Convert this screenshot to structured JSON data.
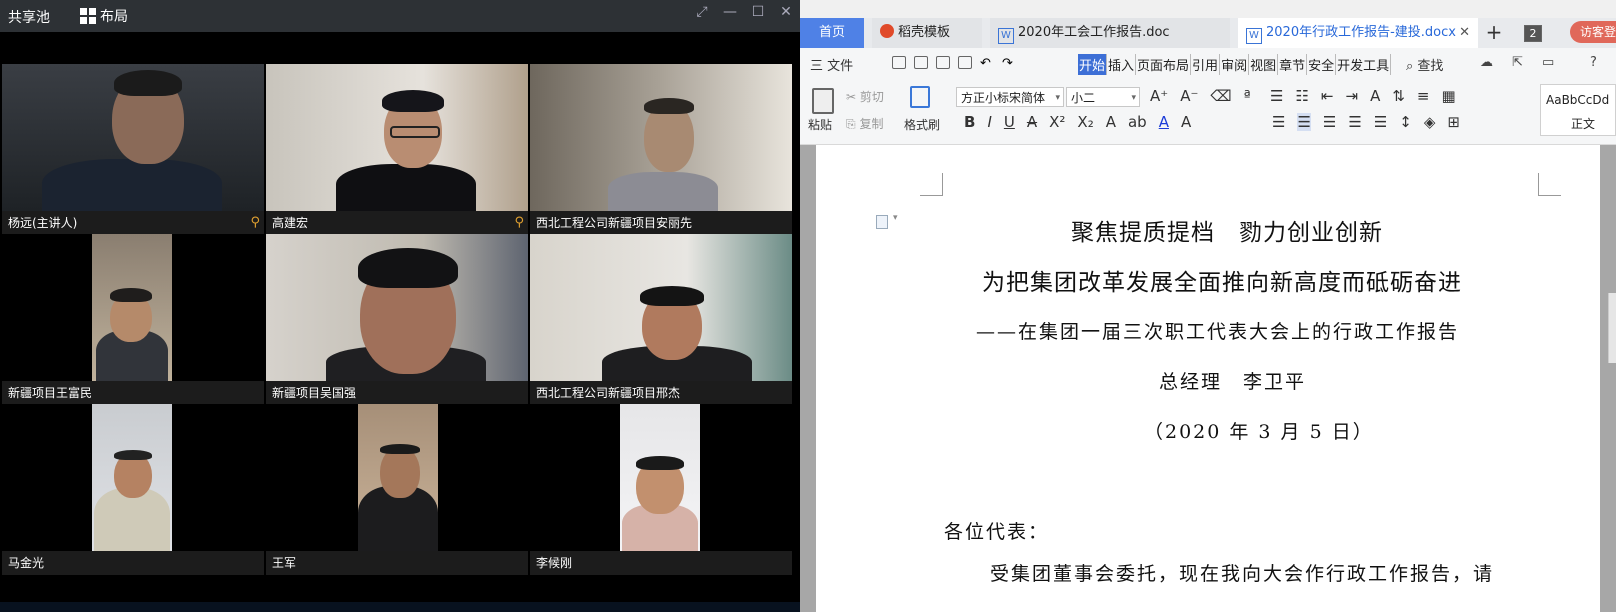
{
  "meeting": {
    "pool_label": "共享池",
    "layout_label": "布局",
    "participants": [
      {
        "name": "杨远(主讲人)",
        "pinned": true
      },
      {
        "name": "高建宏",
        "pinned": true
      },
      {
        "name": "西北工程公司新疆项目安丽先",
        "pinned": false
      },
      {
        "name": "新疆项目王富民",
        "pinned": false
      },
      {
        "name": "新疆项目吴国强",
        "pinned": false
      },
      {
        "name": "西北工程公司新疆项目邢杰",
        "pinned": false
      },
      {
        "name": "马金光",
        "pinned": false
      },
      {
        "name": "王军",
        "pinned": false
      },
      {
        "name": "李候刚",
        "pinned": false
      }
    ]
  },
  "wps": {
    "tabs": {
      "home": "首页",
      "daoke": "稻壳模板",
      "doc1": "2020年工会工作报告.doc",
      "doc2": "2020年行政工作报告-建投.docx"
    },
    "tab_count": "2",
    "visitor_label": "访客登",
    "file_menu": "三 文件",
    "menu_tabs": [
      "开始",
      "插入",
      "页面布局",
      "引用",
      "审阅",
      "视图",
      "章节",
      "安全",
      "开发工具"
    ],
    "find_label": "查找",
    "ribbon": {
      "paste": "粘贴",
      "cut": "剪切",
      "copy": "复制",
      "format_painter": "格式刷",
      "font_name": "方正小标宋简体",
      "font_size": "小二",
      "style_sample": "AaBbCcDd",
      "style_name": "正文"
    },
    "document": {
      "title1": "聚焦提质提档　勠力创业创新",
      "title2": "为把集团改革发展全面推向新高度而砥砺奋进",
      "subtitle": "——在集团一届三次职工代表大会上的行政工作报告",
      "author": "总经理　李卫平",
      "date": "（2020 年 3 月 5 日）",
      "greeting": "各位代表：",
      "para1": "受集团董事会委托，现在我向大会作行政工作报告，请"
    }
  }
}
